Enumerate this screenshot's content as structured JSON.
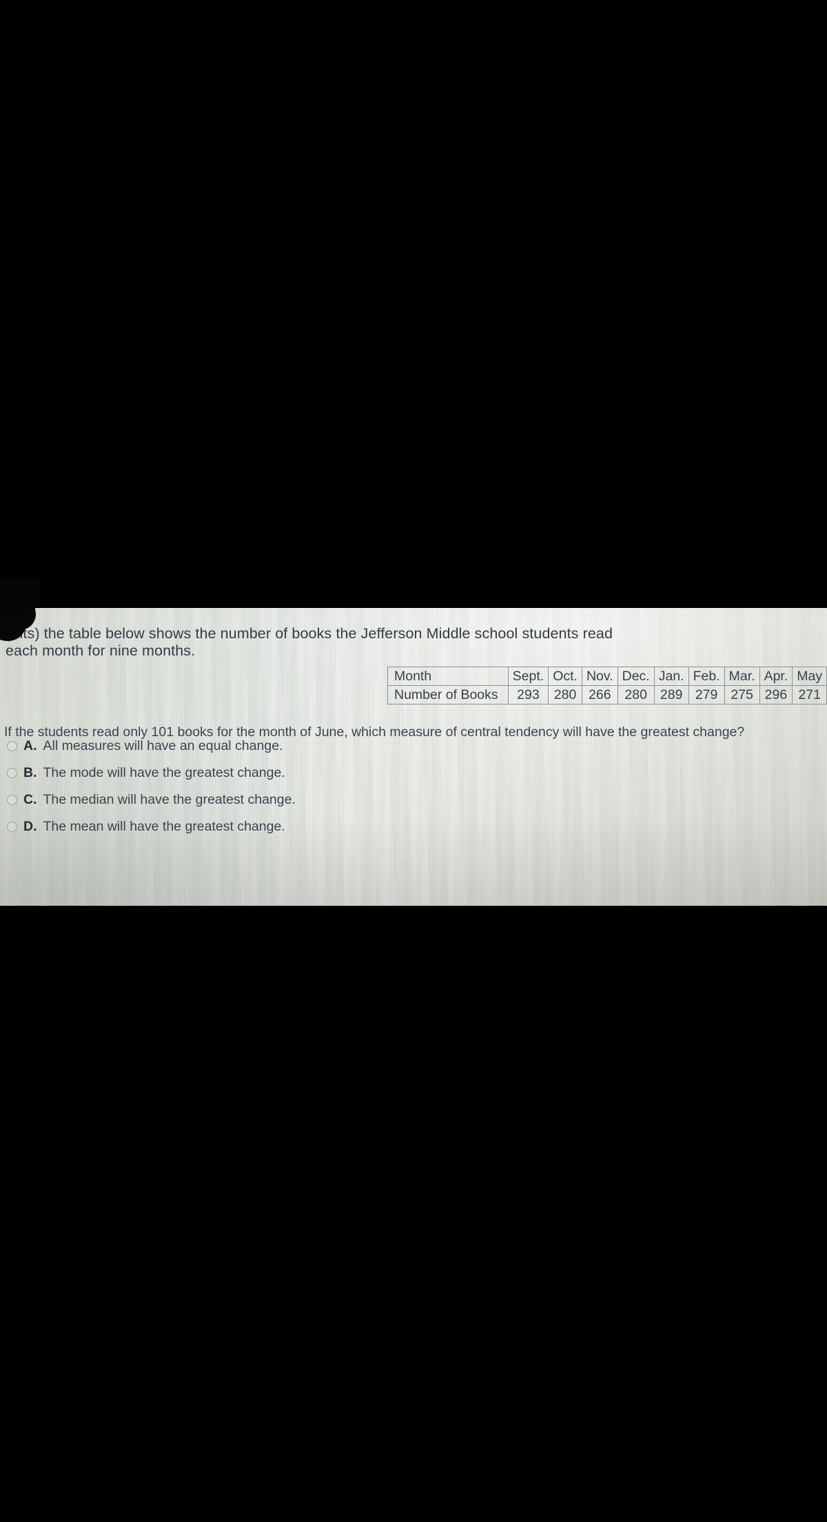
{
  "photo": {
    "background_color": "#e6eae4",
    "outside_color": "#000000"
  },
  "prompt": {
    "line1": "(      nts) the table below shows the number of books the Jefferson Middle school students read",
    "line2": "each month for nine months.",
    "occluded_note": "leading characters hidden by dark blob"
  },
  "table": {
    "row_headers": [
      "Month",
      "Number of Books"
    ],
    "months": [
      "Sept.",
      "Oct.",
      "Nov.",
      "Dec.",
      "Jan.",
      "Feb.",
      "Mar.",
      "Apr.",
      "May"
    ],
    "books": [
      "293",
      "280",
      "266",
      "280",
      "289",
      "279",
      "275",
      "296",
      "271"
    ]
  },
  "question": {
    "text": "If the students read only 101 books for the month of June, which measure of central tendency will have the greatest change?"
  },
  "options": [
    {
      "letter": "A.",
      "text": "All measures will have an equal change.",
      "selected": false
    },
    {
      "letter": "B.",
      "text": "The mode will have the greatest change.",
      "selected": false
    },
    {
      "letter": "C.",
      "text": "The median will have the greatest change.",
      "selected": false
    },
    {
      "letter": "D.",
      "text": "The mean will have the greatest change.",
      "selected": false
    }
  ],
  "chart_data": {
    "type": "table",
    "title": "Number of books read each month for nine months",
    "categories": [
      "Sept.",
      "Oct.",
      "Nov.",
      "Dec.",
      "Jan.",
      "Feb.",
      "Mar.",
      "Apr.",
      "May"
    ],
    "values": [
      293,
      280,
      266,
      280,
      289,
      279,
      275,
      296,
      271
    ],
    "xlabel": "Month",
    "ylabel": "Number of Books",
    "series": [
      {
        "name": "Number of Books",
        "values": [
          293,
          280,
          266,
          280,
          289,
          279,
          275,
          296,
          271
        ]
      }
    ],
    "ylim": [
      266,
      296
    ],
    "grid": true,
    "legend": "none"
  }
}
